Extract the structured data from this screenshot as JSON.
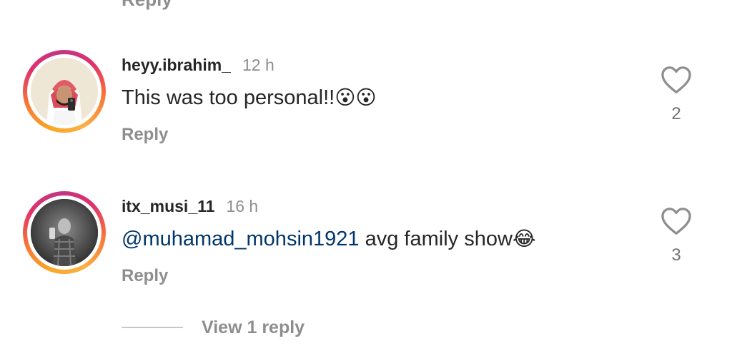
{
  "top": {
    "cut_reply_label": "Reply"
  },
  "comments": [
    {
      "username": "heyy.ibrahim_",
      "time": "12 h",
      "text": "This was too personal!!",
      "emoji": "😮😮",
      "reply_label": "Reply",
      "likes": "2"
    },
    {
      "username": "itx_musi_11",
      "time": "16 h",
      "mention": "@muhamad_mohsin1921",
      "text": " avg family show",
      "emoji": "😂",
      "reply_label": "Reply",
      "likes": "3"
    }
  ],
  "view_replies": {
    "label": "View 1 reply"
  },
  "colors": {
    "username": "#262626",
    "muted": "#8e8e8e",
    "mention": "#00376b",
    "ring_gradient": [
      "#f9a825",
      "#f77737",
      "#e1306c",
      "#c13584"
    ]
  },
  "icons": {
    "like": "heart-outline-icon"
  }
}
